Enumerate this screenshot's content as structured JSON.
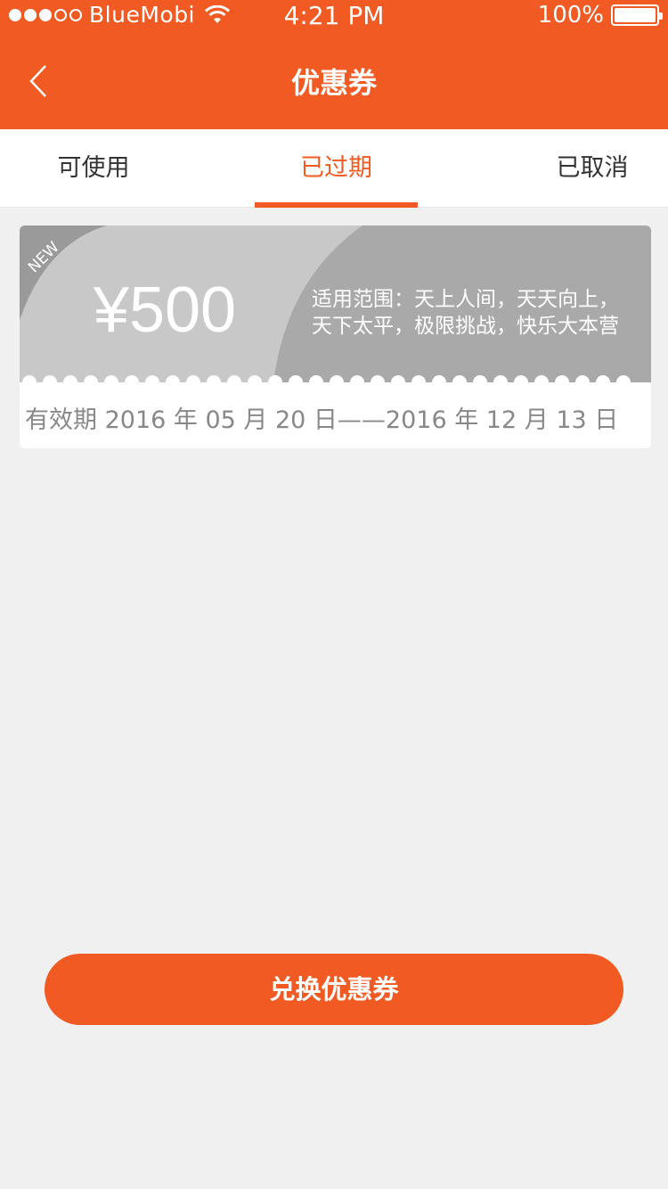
{
  "status_bar": {
    "carrier": "BlueMobi",
    "time": "4:21 PM",
    "battery": "100%",
    "signal_bars_filled": 3,
    "signal_bars_total": 5
  },
  "nav": {
    "title": "优惠券",
    "back_icon": "chevron-left-icon"
  },
  "tabs": [
    {
      "label": "可使用",
      "active": false
    },
    {
      "label": "已过期",
      "active": true
    },
    {
      "label": "已取消",
      "active": false
    }
  ],
  "coupon": {
    "badge": "NEW",
    "amount": "¥500",
    "scope_line1": "适用范围：天上人间，天天向上，",
    "scope_line2": "天下太平，极限挑战，快乐大本营",
    "validity": "有效期 2016 年 05 月 20 日——2016 年 12 月 13 日"
  },
  "redeem_button": "兑换优惠券",
  "colors": {
    "accent": "#f15a22",
    "background": "#f0f0f0",
    "coupon_light": "#c8c8c8",
    "coupon_dark": "#a9a9a9"
  }
}
